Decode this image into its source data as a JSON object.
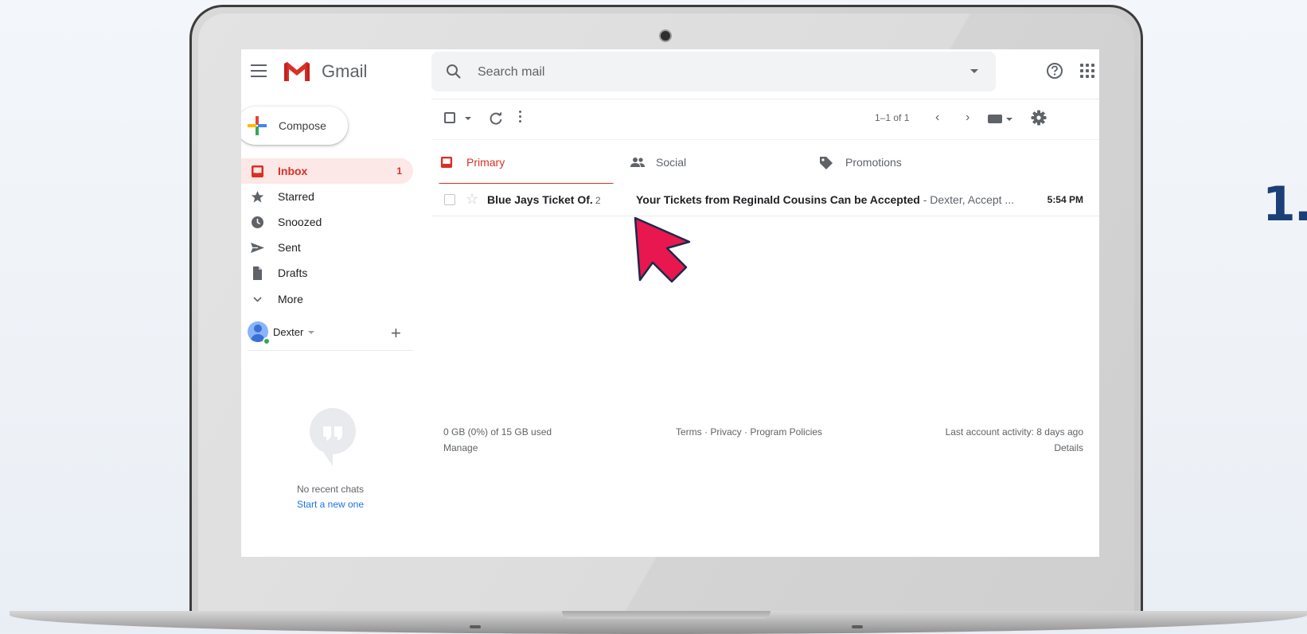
{
  "step_number": "1.",
  "app": {
    "name": "Gmail"
  },
  "search": {
    "placeholder": "Search mail"
  },
  "sidebar": {
    "compose_label": "Compose",
    "items": [
      {
        "label": "Inbox",
        "count": "1",
        "icon": "inbox-icon",
        "active": true
      },
      {
        "label": "Starred",
        "icon": "star-icon"
      },
      {
        "label": "Snoozed",
        "icon": "clock-icon"
      },
      {
        "label": "Sent",
        "icon": "send-icon"
      },
      {
        "label": "Drafts",
        "icon": "file-icon"
      },
      {
        "label": "More",
        "icon": "chevron-down-icon"
      }
    ],
    "user": {
      "name": "Dexter"
    },
    "chat": {
      "empty_text": "No recent chats",
      "start_link": "Start a new one"
    }
  },
  "toolbar": {
    "pagination": "1–1 of 1"
  },
  "tabs": [
    {
      "label": "Primary",
      "active": true
    },
    {
      "label": "Social"
    },
    {
      "label": "Promotions"
    }
  ],
  "emails": [
    {
      "sender": "Blue Jays Ticket Of.",
      "thread_count": "2",
      "subject": "Your Tickets from Reginald Cousins Can be Accepted",
      "snippet": " - Dexter, Accept ...",
      "time": "5:54 PM"
    }
  ],
  "footer": {
    "storage": "0 GB (0%) of 15 GB used",
    "manage": "Manage",
    "policies": "Terms · Privacy · Program Policies",
    "activity": "Last account activity: 8 days ago",
    "details": "Details"
  },
  "colors": {
    "accent": "#d93025",
    "step_number": "#1c3f78",
    "cursor": "#e8174f"
  }
}
